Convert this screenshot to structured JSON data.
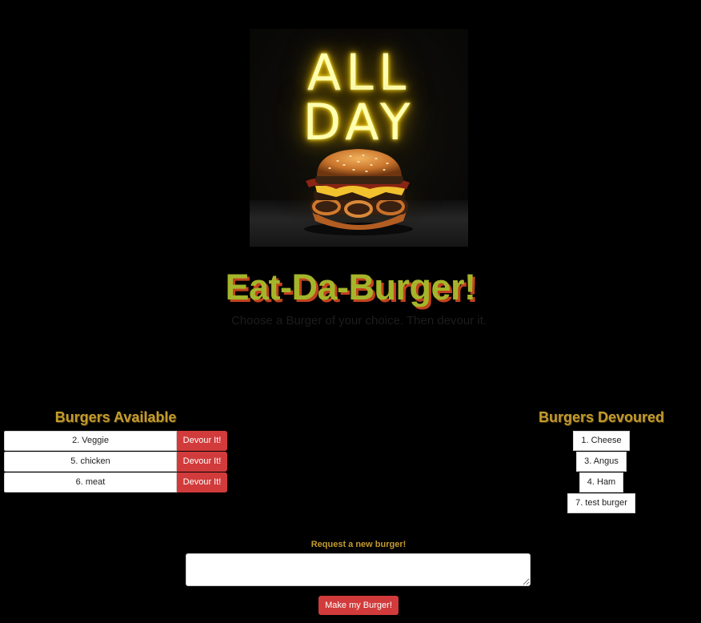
{
  "hero": {
    "neon_line1": "ALL",
    "neon_line2": "DAY"
  },
  "header": {
    "title": "Eat-Da-Burger!",
    "subtitle": "Choose a Burger of your choice. Then devour it."
  },
  "available": {
    "heading": "Burgers Available",
    "items": [
      {
        "label": "2. Veggie",
        "action": "Devour It!"
      },
      {
        "label": "5. chicken",
        "action": "Devour It!"
      },
      {
        "label": "6. meat",
        "action": "Devour It!"
      }
    ]
  },
  "devoured": {
    "heading": "Burgers Devoured",
    "items": [
      {
        "label": "1. Cheese"
      },
      {
        "label": "3. Angus"
      },
      {
        "label": "4. Ham"
      },
      {
        "label": "7. test burger"
      }
    ]
  },
  "form": {
    "label": "Request a new burger!",
    "input_value": "",
    "submit_label": "Make my Burger!"
  },
  "colors": {
    "background": "#000000",
    "title": "#a5b52a",
    "title_shadow": "#c2421e",
    "heading": "#c39a2e",
    "button": "#d13b3b"
  },
  "icons": [
    "resize-handle-icon"
  ]
}
